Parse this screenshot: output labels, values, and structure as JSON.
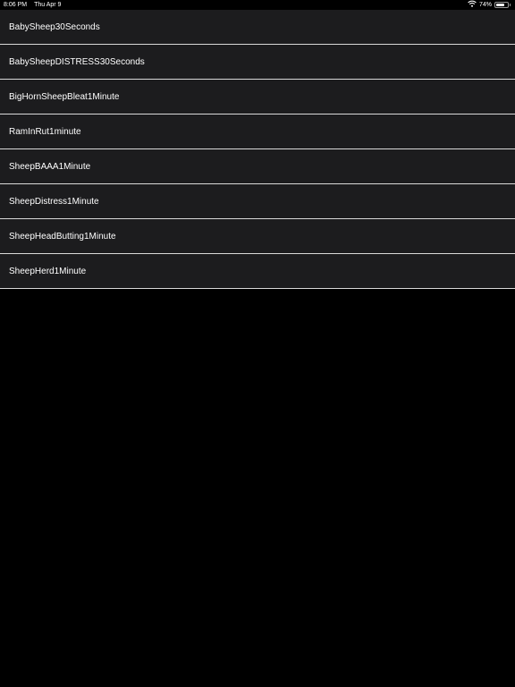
{
  "status_bar": {
    "time": "8:06 PM",
    "date": "Thu Apr 9",
    "battery_percent_label": "74%",
    "battery_level": 0.74
  },
  "sounds": [
    {
      "label": "BabySheep30Seconds"
    },
    {
      "label": "BabySheepDISTRESS30Seconds"
    },
    {
      "label": "BigHornSheepBleat1Minute"
    },
    {
      "label": "RamInRut1minute"
    },
    {
      "label": "SheepBAAA1Minute"
    },
    {
      "label": "SheepDistress1Minute"
    },
    {
      "label": "SheepHeadButting1Minute"
    },
    {
      "label": "SheepHerd1Minute"
    }
  ],
  "colors": {
    "background": "#000000",
    "row_background": "#1c1c1e",
    "separator": "#d9d9d9",
    "text": "#ffffff"
  },
  "icons": [
    "wifi-icon",
    "battery-icon"
  ]
}
